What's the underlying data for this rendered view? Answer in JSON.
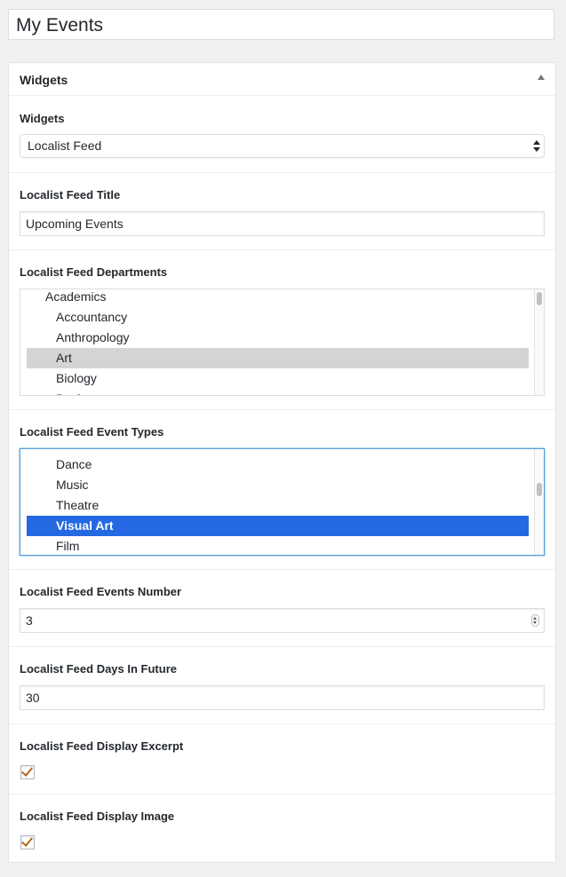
{
  "page": {
    "title": "My Events"
  },
  "panel": {
    "title": "Widgets"
  },
  "fields": {
    "widgets": {
      "label": "Widgets",
      "value": "Localist Feed"
    },
    "feed_title": {
      "label": "Localist Feed Title",
      "value": "Upcoming Events"
    },
    "departments": {
      "label": "Localist Feed Departments",
      "items": [
        "Academics",
        "Accountancy",
        "Anthropology",
        "Art",
        "Biology",
        "Business"
      ],
      "selected": "Art"
    },
    "event_types": {
      "label": "Localist Feed Event Types",
      "items": [
        "Dance",
        "Music",
        "Theatre",
        "Visual Art",
        "Film"
      ],
      "selected": "Visual Art"
    },
    "events_number": {
      "label": "Localist Feed Events Number",
      "value": "3"
    },
    "days_in_future": {
      "label": "Localist Feed Days In Future",
      "value": "30"
    },
    "display_excerpt": {
      "label": "Localist Feed Display Excerpt",
      "checked": true
    },
    "display_image": {
      "label": "Localist Feed Display Image",
      "checked": true
    }
  },
  "colors": {
    "selection_blue": "#2469e2",
    "selection_grey": "#d4d4d4",
    "checkmark": "#b2661b"
  }
}
